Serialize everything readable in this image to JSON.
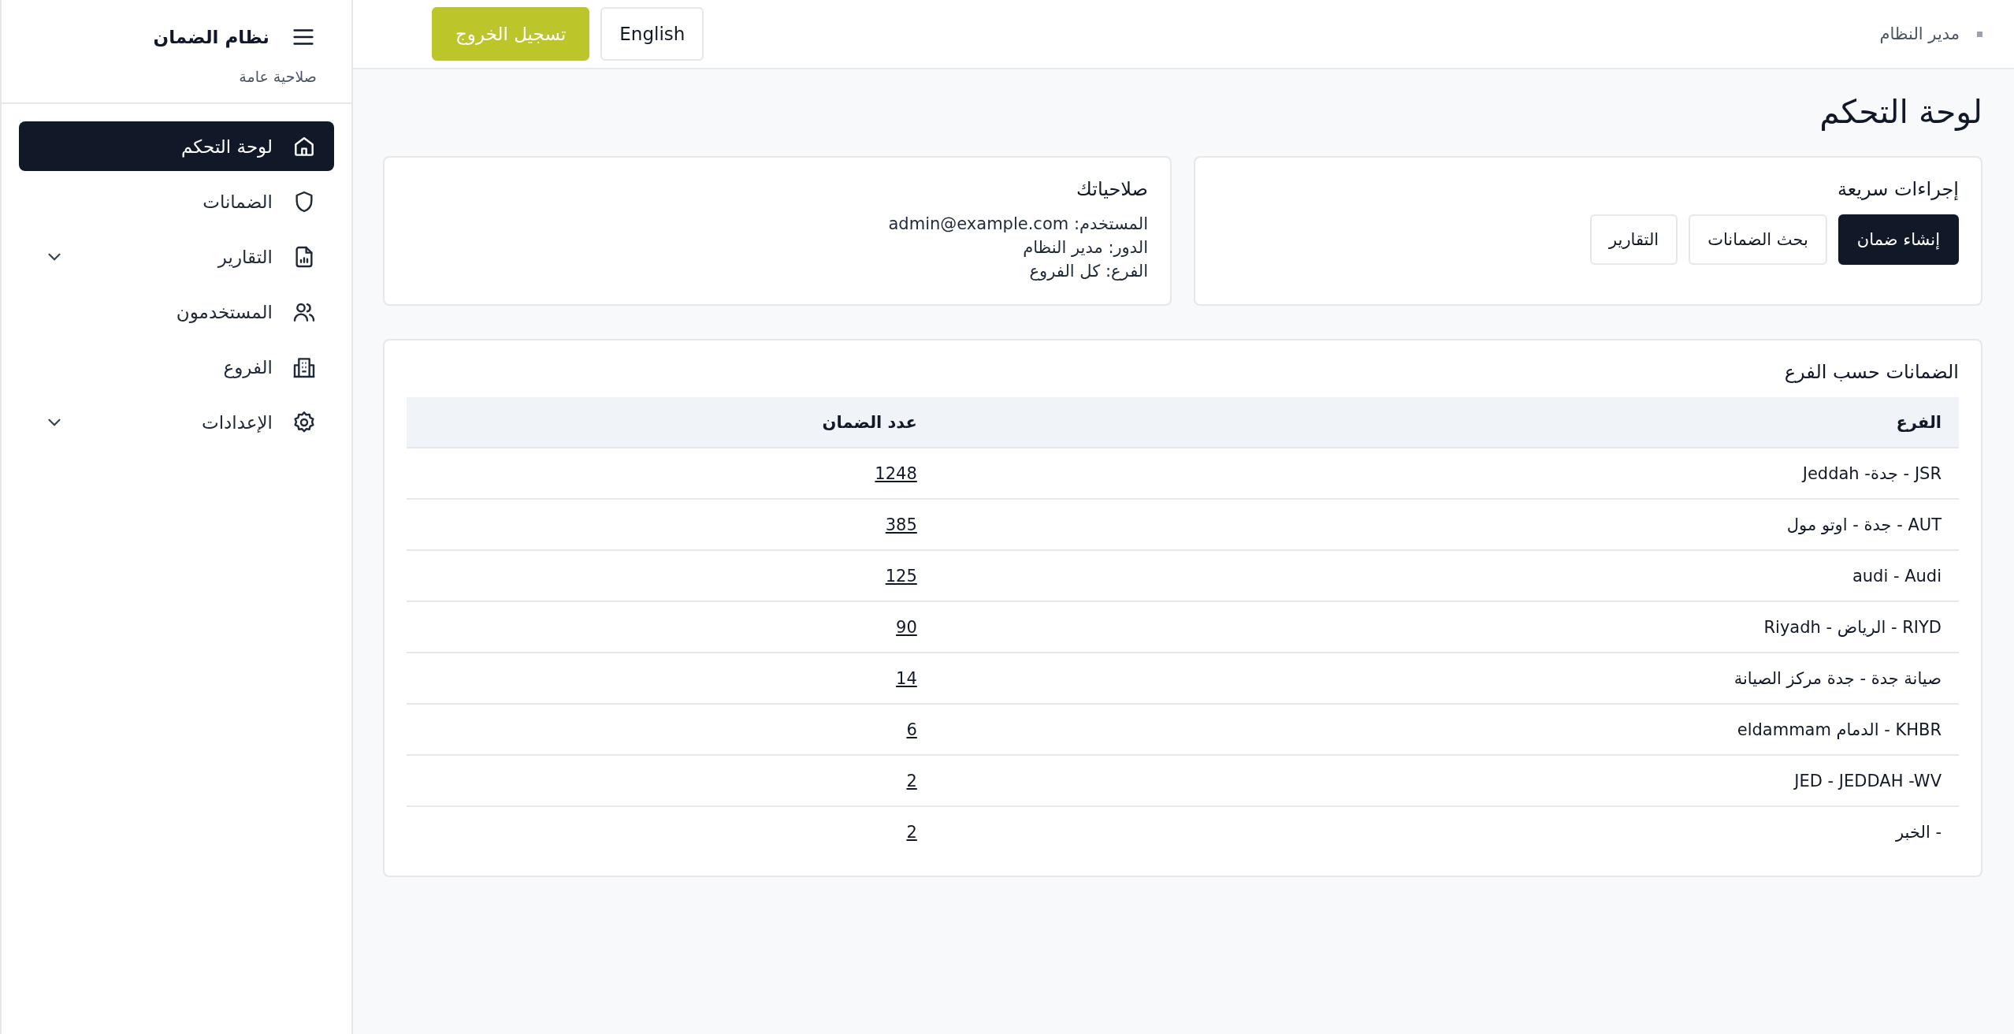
{
  "sidebar": {
    "title": "نظام الضمان",
    "subtitle": "صلاحية عامة",
    "items": [
      {
        "label": "لوحة التحكم",
        "selected": true,
        "submenu": false
      },
      {
        "label": "الضمانات",
        "selected": false,
        "submenu": false
      },
      {
        "label": "التقارير",
        "selected": false,
        "submenu": true
      },
      {
        "label": "المستخدمون",
        "selected": false,
        "submenu": false
      },
      {
        "label": "الفروع",
        "selected": false,
        "submenu": false
      },
      {
        "label": "الإعدادات",
        "selected": false,
        "submenu": true
      }
    ]
  },
  "topbar": {
    "user": "مدير النظام",
    "buttons": [
      {
        "label": "English",
        "kind": "outline"
      },
      {
        "label": "تسجيل الخروج",
        "kind": "accent"
      }
    ]
  },
  "page_title": "لوحة التحكم",
  "quick_actions": {
    "title": "إجراءات سريعة",
    "buttons": [
      {
        "label": "إنشاء ضمان",
        "kind": "primary"
      },
      {
        "label": "بحث الضمانات",
        "kind": "outline"
      },
      {
        "label": "التقارير",
        "kind": "outline"
      }
    ]
  },
  "permissions": {
    "title": "صلاحياتك",
    "lines": [
      "المستخدم: admin@example.com",
      "الدور: مدير النظام",
      "الفرع: كل الفروع"
    ]
  },
  "branches_table": {
    "title": "الضمانات حسب الفرع",
    "columns": [
      "الفرع",
      "عدد الضمان"
    ],
    "rows": [
      {
        "branch": "JSR - جدة- Jeddah",
        "count": "1248"
      },
      {
        "branch": "AUT - جدة - اوتو مول",
        "count": "385"
      },
      {
        "branch": "audi - Audi",
        "count": "125"
      },
      {
        "branch": "RIYD - الرياض - Riyadh",
        "count": "90"
      },
      {
        "branch": "صيانة جدة - جدة مركز الصيانة",
        "count": "14"
      },
      {
        "branch": "KHBR - الدمام eldammam",
        "count": "6"
      },
      {
        "branch": "JED - JEDDAH -WV",
        "count": "2"
      },
      {
        "branch": "- الخبر",
        "count": "2"
      }
    ]
  }
}
